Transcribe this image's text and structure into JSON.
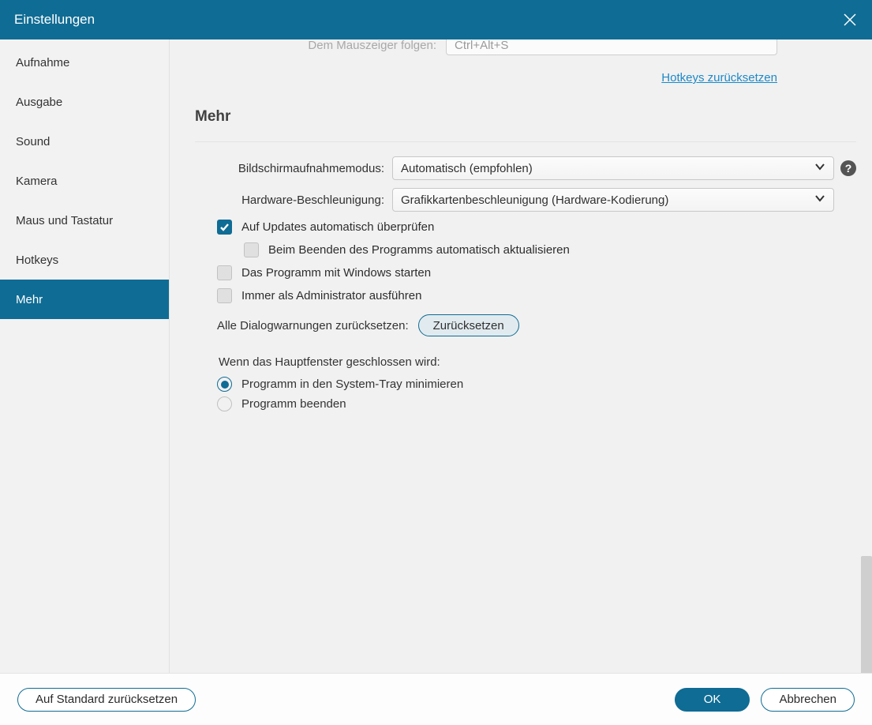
{
  "window": {
    "title": "Einstellungen"
  },
  "sidebar": {
    "items": [
      {
        "label": "Aufnahme"
      },
      {
        "label": "Ausgabe"
      },
      {
        "label": "Sound"
      },
      {
        "label": "Kamera"
      },
      {
        "label": "Maus und Tastatur"
      },
      {
        "label": "Hotkeys"
      },
      {
        "label": "Mehr"
      }
    ],
    "active_index": 6
  },
  "partial": {
    "label": "Dem Mauszeiger folgen:",
    "hotkey": "Ctrl+Alt+S",
    "reset_link": "Hotkeys zurücksetzen"
  },
  "section": {
    "title": "Mehr"
  },
  "form": {
    "capture_mode_label": "Bildschirmaufnahmemodus:",
    "capture_mode_value": "Automatisch (empfohlen)",
    "hw_accel_label": "Hardware-Beschleunigung:",
    "hw_accel_value": "Grafikkartenbeschleunigung (Hardware-Kodierung)"
  },
  "checks": {
    "auto_update": "Auf Updates automatisch überprüfen",
    "update_on_exit": "Beim Beenden des Programms automatisch aktualisieren",
    "start_with_windows": "Das Programm mit Windows starten",
    "run_as_admin": "Immer als Administrator ausführen"
  },
  "reset_dialogs": {
    "label": "Alle Dialogwarnungen zurücksetzen:",
    "button": "Zurücksetzen"
  },
  "close_action": {
    "title": "Wenn das Hauptfenster geschlossen wird:",
    "minimize": "Programm in den System-Tray minimieren",
    "exit": "Programm beenden"
  },
  "footer": {
    "reset_defaults": "Auf Standard zurücksetzen",
    "ok": "OK",
    "cancel": "Abbrechen"
  }
}
